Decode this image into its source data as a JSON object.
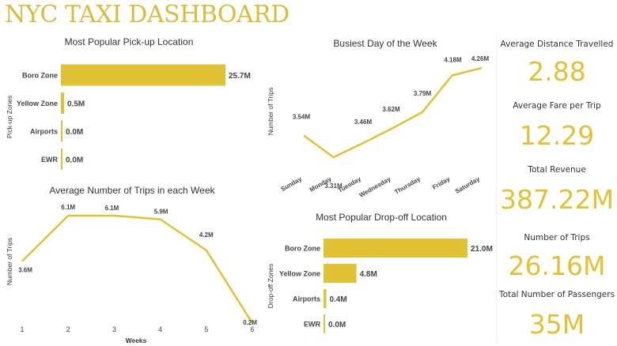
{
  "dashboard": {
    "title": "NYC TAXI DASHBOARD"
  },
  "colors": {
    "accent": "#e2c235",
    "bar": "#e2c235",
    "text": "#333333"
  },
  "kpis": [
    {
      "label": "Average Distance Travelled",
      "value": "2.88"
    },
    {
      "label": "Average Fare per Trip",
      "value": "12.29"
    },
    {
      "label": "Total Revenue",
      "value": "387.22M"
    },
    {
      "label": "Number of Trips",
      "value": "26.16M"
    },
    {
      "label": "Total Number of Passengers",
      "value": "35M"
    }
  ],
  "chart_data": [
    {
      "id": "pickup",
      "type": "bar",
      "orientation": "horizontal",
      "title": "Most Popular Pick-up Location",
      "ylabel": "Pick-up Zones",
      "xlabel": "",
      "categories": [
        "Boro Zone",
        "Yellow Zone",
        "Airports",
        "EWR"
      ],
      "values": [
        25.7,
        0.5,
        0.0,
        0.0
      ],
      "labels": [
        "25.7M",
        "0.5M",
        "0.0M",
        "0.0M"
      ],
      "xlim": [
        0,
        25.7
      ]
    },
    {
      "id": "weekday",
      "type": "line",
      "title": "Busiest Day of the Week",
      "ylabel": "Number of Trips",
      "xlabel": "",
      "categories": [
        "Sunday",
        "Monday",
        "Tuesday",
        "Wednesday",
        "Thursday",
        "Friday",
        "Saturday"
      ],
      "values": [
        3.54,
        3.31,
        3.46,
        3.62,
        3.79,
        4.18,
        4.26
      ],
      "labels": [
        "3.54M",
        "3.31M",
        "3.46M",
        "3.62M",
        "3.79M",
        "4.18M",
        "4.26M"
      ],
      "ylim": [
        3.31,
        4.26
      ]
    },
    {
      "id": "weekly",
      "type": "line",
      "title": "Average Number of Trips in each Week",
      "ylabel": "Number of Trips",
      "xlabel": "Weeks",
      "categories": [
        "1",
        "2",
        "3",
        "4",
        "5",
        "6"
      ],
      "values": [
        3.6,
        6.1,
        6.1,
        5.9,
        4.2,
        0.2
      ],
      "labels": [
        "3.6M",
        "6.1M",
        "6.1M",
        "5.9M",
        "4.2M",
        "0.2M"
      ],
      "ylim": [
        0.2,
        6.1
      ]
    },
    {
      "id": "dropoff",
      "type": "bar",
      "orientation": "horizontal",
      "title": "Most Popular Drop-off Location",
      "ylabel": "Drop-off Zones",
      "xlabel": "",
      "categories": [
        "Boro Zone",
        "Yellow Zone",
        "Airports",
        "EWR"
      ],
      "values": [
        21.0,
        4.8,
        0.4,
        0.0
      ],
      "labels": [
        "21.0M",
        "4.8M",
        "0.4M",
        "0.0M"
      ],
      "xlim": [
        0,
        21.0
      ]
    }
  ]
}
